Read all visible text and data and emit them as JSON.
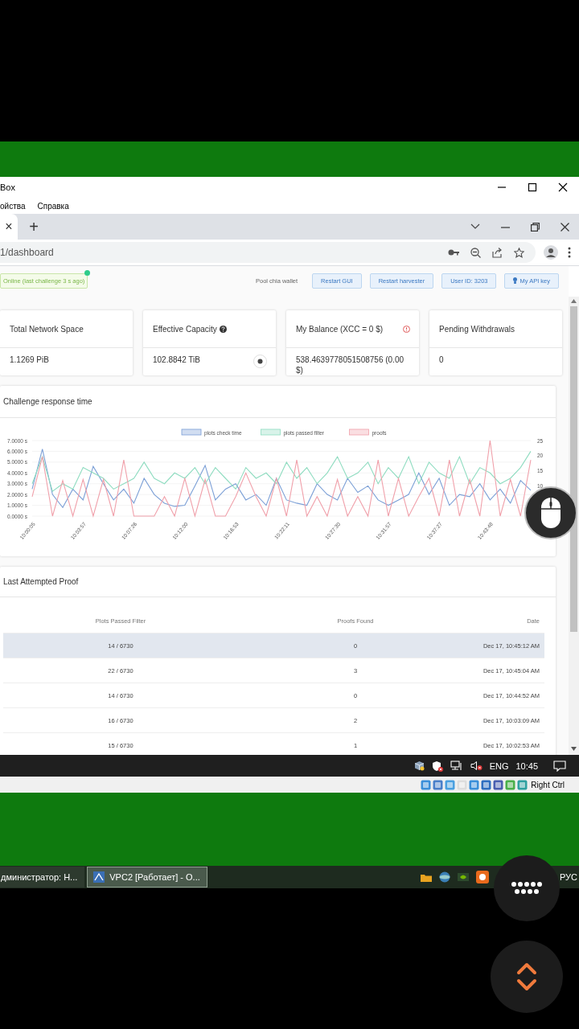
{
  "vbox_window": {
    "title": "Box",
    "menu": [
      "ойства",
      "Справка"
    ]
  },
  "browser": {
    "tab_close": "×",
    "new_tab": "+",
    "url": "1/dashboard"
  },
  "toolbar": {
    "status": "Online (last challenge 3 s ago)",
    "pool_label": "Pool chia wallet",
    "buttons": [
      "Restart GUI",
      "Restart harvester",
      "User ID: 3203",
      "My API key"
    ]
  },
  "cards": [
    {
      "title": "Total Network Space",
      "value": "1.1269 PiB",
      "kind": "plain"
    },
    {
      "title": "Effective Capacity",
      "value": "102.8842 TiB",
      "kind": "help"
    },
    {
      "title": "My Balance (XCC = 0 $)",
      "value": "538.4639778051508756 (0.00 $)",
      "kind": "warning"
    },
    {
      "title": "Pending Withdrawals",
      "value": "0",
      "kind": "plain"
    }
  ],
  "chart_card": {
    "title": "Challenge response time",
    "secondary_yticks": [
      "25",
      "20",
      "15",
      "10"
    ],
    "chart_data": {
      "type": "line",
      "grid": true,
      "legend": true,
      "categories": [
        "10:00:05",
        null,
        null,
        null,
        null,
        "10:03:57",
        null,
        null,
        null,
        null,
        "10:07:26",
        null,
        null,
        null,
        null,
        "10:12:00",
        null,
        null,
        null,
        null,
        "10:16:53",
        null,
        null,
        null,
        null,
        "10:22:11",
        null,
        null,
        null,
        null,
        "10:27:30",
        null,
        null,
        null,
        null,
        "10:31:57",
        null,
        null,
        null,
        null,
        "10:37:27",
        null,
        null,
        null,
        null,
        "10:43:48",
        null,
        null,
        null,
        null
      ],
      "ylim": [
        0,
        7
      ],
      "yticks": [
        {
          "value": 0,
          "label": "0.0000 s"
        },
        {
          "value": 1,
          "label": "1.0000 s"
        },
        {
          "value": 2,
          "label": "2.0000 s"
        },
        {
          "value": 3,
          "label": "3.0000 s"
        },
        {
          "value": 4,
          "label": "4.0000 s"
        },
        {
          "value": 5,
          "label": "5.0000 s"
        },
        {
          "value": 6,
          "label": "6.0000 s"
        },
        {
          "value": 7,
          "label": "7.0000 s"
        }
      ],
      "series": [
        {
          "name": "plots check time",
          "color": "#7b9fd6",
          "values": [
            2.5,
            6.2,
            2.0,
            0.8,
            2.5,
            1.5,
            4.6,
            3.0,
            1.5,
            2.5,
            1.2,
            3.5,
            2.0,
            1.2,
            0.9,
            1.0,
            2.8,
            4.7,
            1.5,
            2.5,
            3.0,
            1.5,
            2.0,
            1.0,
            3.5,
            1.5,
            1.2,
            1.0,
            3.0,
            2.0,
            1.5,
            3.5,
            2.2,
            2.8,
            1.5,
            1.0,
            1.5,
            2.0,
            4.0,
            2.0,
            3.5,
            1.0,
            2.0,
            1.8,
            3.0,
            1.5,
            2.5,
            1.2,
            3.3,
            2.4
          ]
        },
        {
          "name": "plots passed filter",
          "color": "#8fdcc0",
          "values": [
            3.0,
            5.5,
            2.3,
            3.0,
            2.5,
            4.5,
            4.0,
            3.5,
            2.5,
            3.0,
            3.5,
            5.0,
            3.5,
            3.0,
            4.0,
            3.5,
            4.5,
            3.0,
            4.5,
            3.5,
            2.5,
            4.5,
            3.5,
            4.0,
            3.0,
            5.0,
            3.5,
            4.5,
            3.0,
            4.0,
            5.5,
            3.5,
            4.0,
            5.0,
            3.0,
            4.5,
            3.5,
            5.5,
            3.0,
            5.0,
            4.0,
            3.5,
            5.5,
            3.0,
            4.5,
            4.0,
            3.0,
            3.5,
            4.5,
            6.0
          ]
        },
        {
          "name": "proofs",
          "color": "#f0a0aa",
          "values": [
            1.8,
            5.5,
            0,
            3.3,
            0,
            3.4,
            0,
            3.4,
            0,
            5.2,
            0,
            0,
            0,
            1.8,
            0,
            3.5,
            0,
            3.4,
            0,
            0,
            1.8,
            4.0,
            1.8,
            0,
            3.5,
            0,
            5.2,
            0,
            1.8,
            0,
            3.4,
            0,
            1.8,
            0,
            5.2,
            0,
            3.5,
            0,
            1.8,
            3.5,
            0,
            5.2,
            0,
            3.4,
            0,
            7.0,
            0,
            3.4,
            0,
            5.2
          ]
        }
      ]
    }
  },
  "proof_table": {
    "title": "Last Attempted Proof",
    "columns": [
      "Plots Passed Filter",
      "Proofs Found",
      "Date"
    ],
    "rows": [
      {
        "cells": [
          "14 / 6730",
          "0",
          "Dec 17, 10:45:12 AM"
        ],
        "highlighted": true
      },
      {
        "cells": [
          "22 / 6730",
          "3",
          "Dec 17, 10:45:04 AM"
        ],
        "highlighted": false
      },
      {
        "cells": [
          "14 / 6730",
          "0",
          "Dec 17, 10:44:52 AM"
        ],
        "highlighted": false
      },
      {
        "cells": [
          "16 / 6730",
          "2",
          "Dec 17, 10:03:09 AM"
        ],
        "highlighted": false
      },
      {
        "cells": [
          "15 / 6730",
          "1",
          "Dec 17, 10:02:53 AM"
        ],
        "highlighted": false
      }
    ]
  },
  "vm_taskbar": {
    "language": "ENG",
    "time": "10:45"
  },
  "vbox_status": {
    "host_key": "Right Ctrl"
  },
  "host_taskbar": {
    "tasks": [
      {
        "label": "дминистратор: Н...",
        "selected": false
      },
      {
        "label": "VPC2 [Работает] - О...",
        "selected": true
      }
    ],
    "language": "РУС"
  }
}
